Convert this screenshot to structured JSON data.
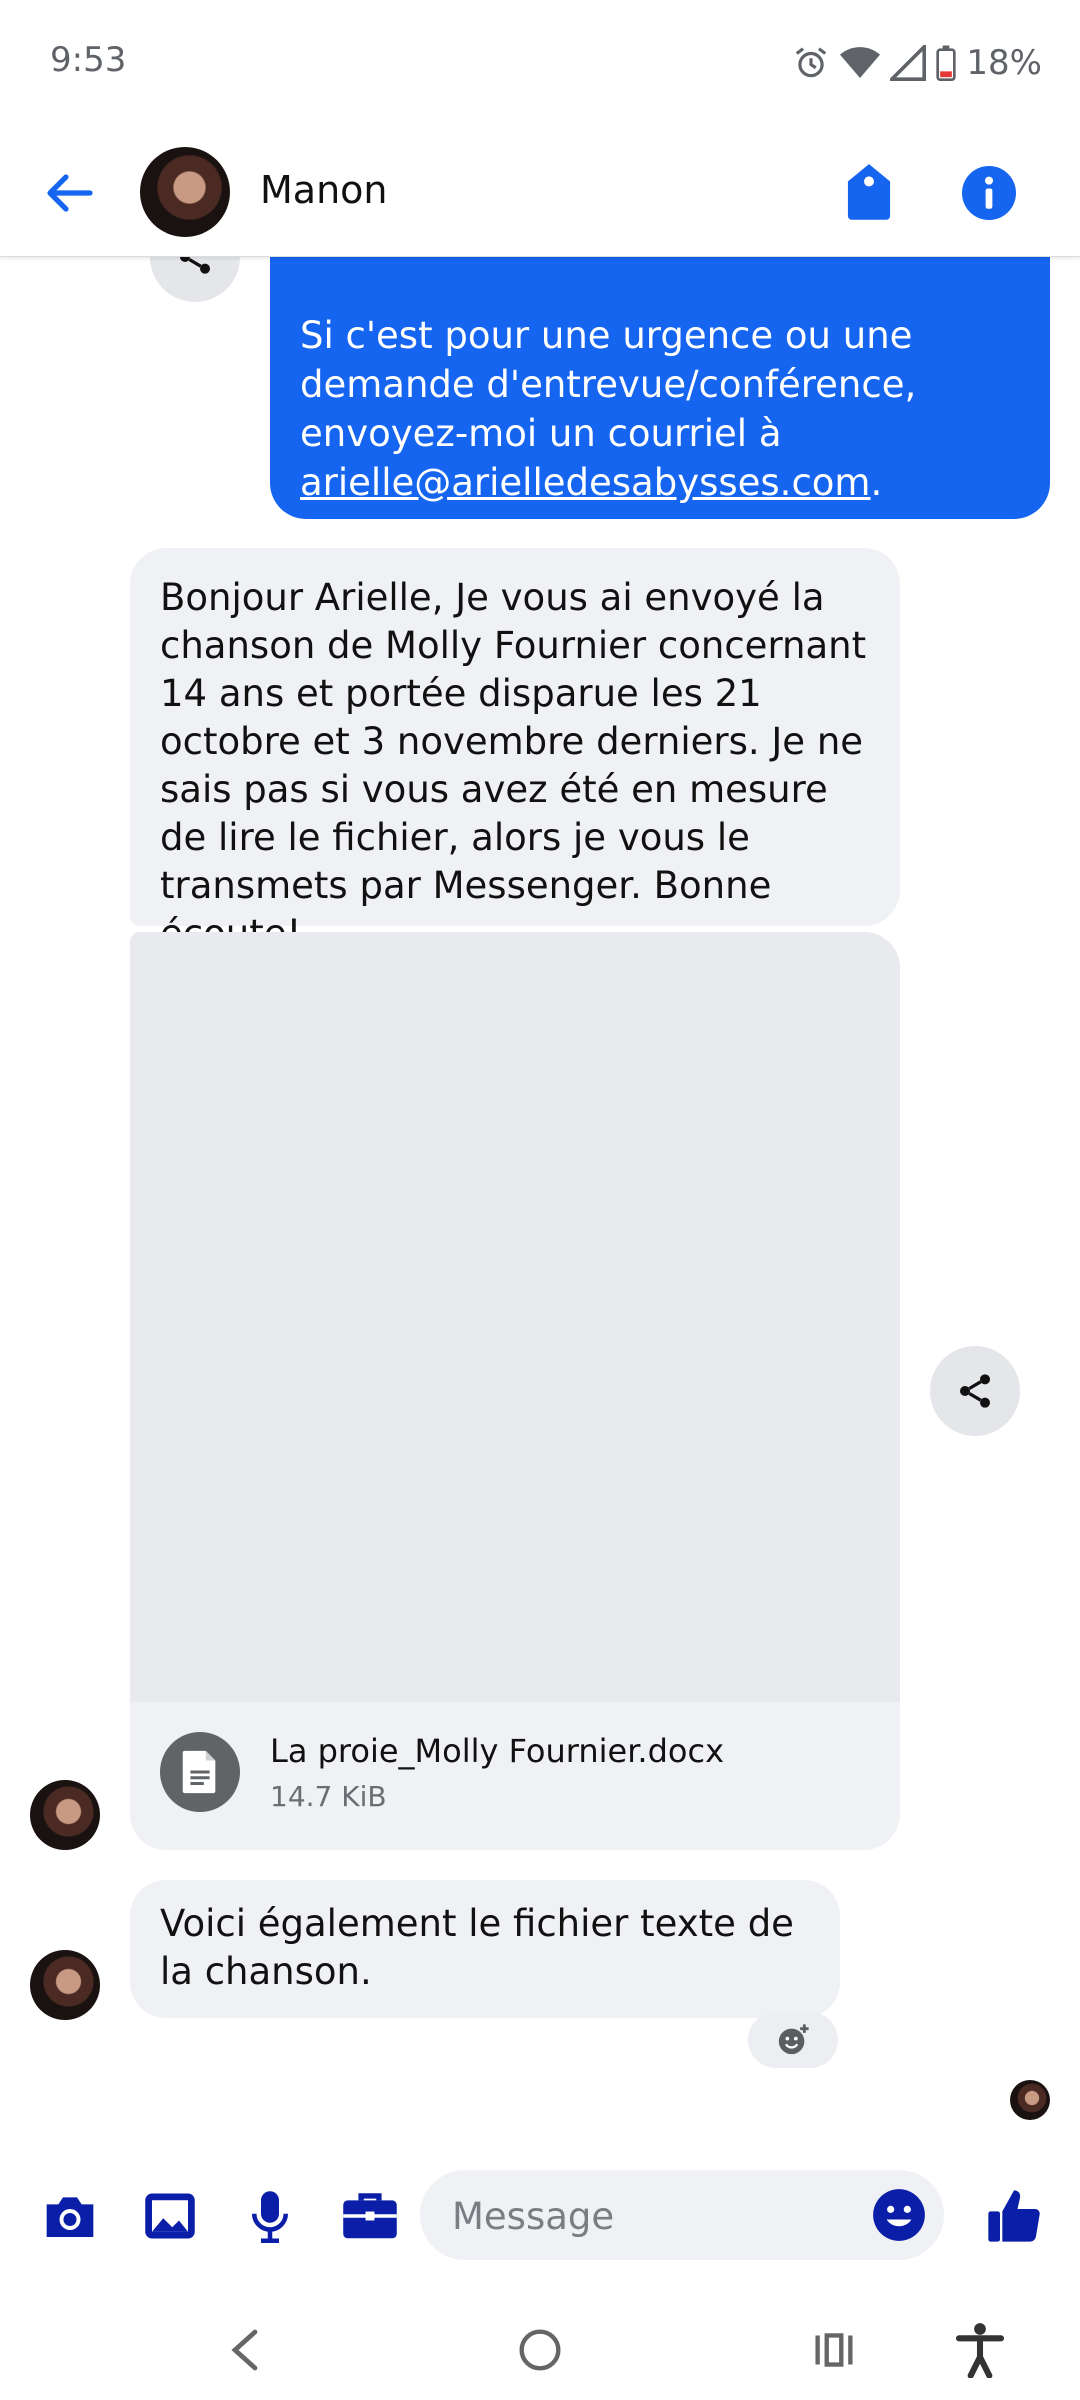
{
  "status_bar": {
    "time": "9:53",
    "battery": "18%"
  },
  "header": {
    "contact_name": "Manon"
  },
  "messages": {
    "outgoing_tail": [
      "Si c'est pour une urgence ou une demande d'entrevue/conférence, envoyez-moi un courriel à ",
      "arielle@arielledesabysses.com",
      "."
    ],
    "incoming_1": "Bonjour Arielle,  Je vous ai envoyé la chanson de Molly Fournier concernant 14 ans et portée disparue les 21 octobre et 3 novembre derniers.  Je ne sais pas si vous avez été en mesure de lire le fichier, alors je vous le transmets par Messenger.  Bonne écoute!",
    "attachment": {
      "file_name": "La proie_Molly Fournier.docx",
      "file_size": "14.7 KiB"
    },
    "incoming_2": "Voici également le fichier texte de la chanson."
  },
  "composer": {
    "placeholder": "Message"
  },
  "colors": {
    "accent": "#1565f0",
    "icon_blue": "#0a1ea8",
    "bubble_in": "#f0f1f4"
  },
  "icons": [
    "back-arrow-icon",
    "tag-icon",
    "info-icon",
    "share-icon",
    "document-icon",
    "add-reaction-icon",
    "camera-icon",
    "gallery-icon",
    "microphone-icon",
    "briefcase-icon",
    "emoji-icon",
    "thumbs-up-icon",
    "nav-back-icon",
    "nav-home-icon",
    "nav-recents-icon",
    "accessibility-icon"
  ]
}
